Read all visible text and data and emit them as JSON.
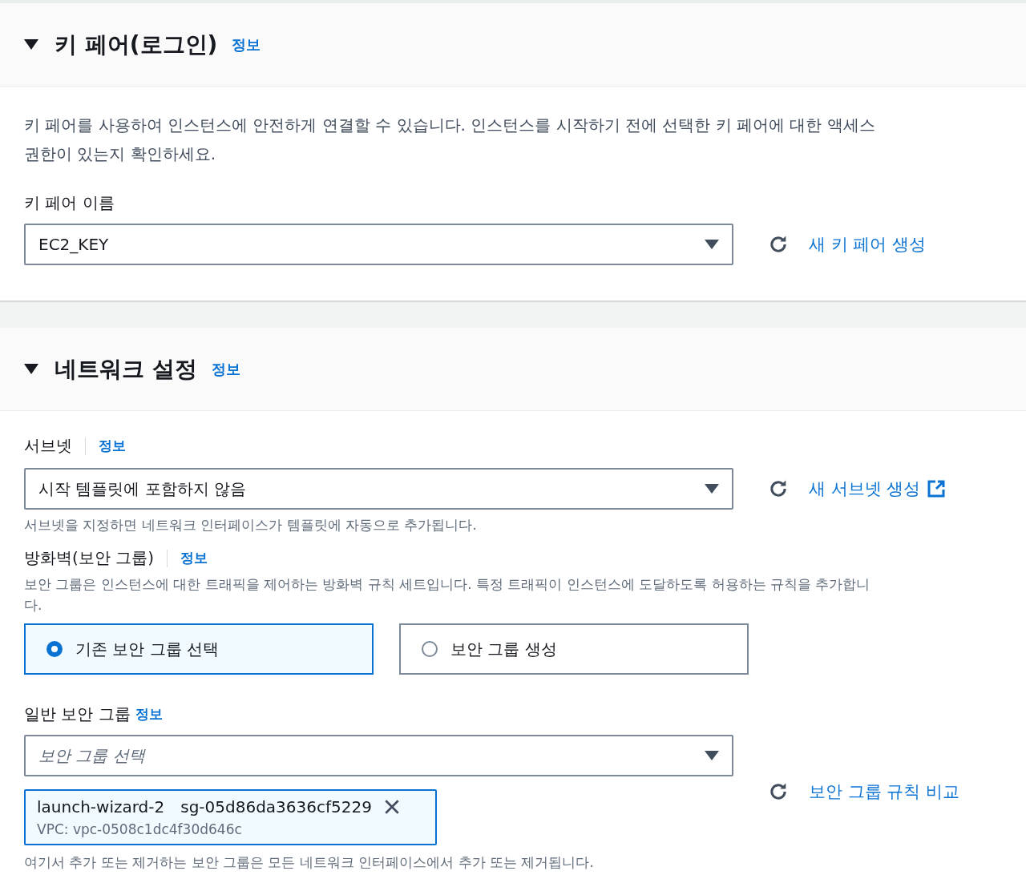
{
  "key_pair_section": {
    "title": "키 페어(로그인)",
    "info_link": "정보",
    "expanded": true,
    "description": "키 페어를 사용하여 인스턴스에 안전하게 연결할 수 있습니다. 인스턴스를 시작하기 전에 선택한 키 페어에 대한 액세스 권한이 있는지 확인하세요.",
    "key_pair_name": {
      "label": "키 페어 이름",
      "value": "EC2_KEY"
    },
    "create_link": "새 키 페어 생성"
  },
  "network_section": {
    "title": "네트워크 설정",
    "info_link": "정보",
    "expanded": true,
    "subnet": {
      "label": "서브넷",
      "info_link": "정보",
      "value": "시작 템플릿에 포함하지 않음",
      "create_link": "새 서브넷 생성",
      "hint": "서브넷을 지정하면 네트워크 인터페이스가 템플릿에 자동으로 추가됩니다."
    },
    "firewall": {
      "label": "방화벽(보안 그룹)",
      "info_link": "정보",
      "description": "보안 그룹은 인스턴스에 대한 트래픽을 제어하는 방화벽 규칙 세트입니다. 특정 트래픽이 인스턴스에 도달하도록 허용하는 규칙을 추가합니다.",
      "options": [
        {
          "label": "기존 보안 그룹 선택",
          "selected": true
        },
        {
          "label": "보안 그룹 생성",
          "selected": false
        }
      ]
    },
    "common_security_groups": {
      "label": "일반 보안 그룹",
      "info_link": "정보",
      "placeholder": "보안 그룹 선택",
      "compare_link": "보안 그룹 규칙 비교",
      "tokens": [
        {
          "name": "launch-wizard-2",
          "id": "sg-05d86da3636cf5229",
          "vpc": "VPC: vpc-0508c1dc4f30d646c"
        }
      ],
      "hint": "여기서 추가 또는 제거하는 보안 그룹은 모든 네트워크 인터페이스에서 추가 또는 제거됩니다."
    }
  }
}
